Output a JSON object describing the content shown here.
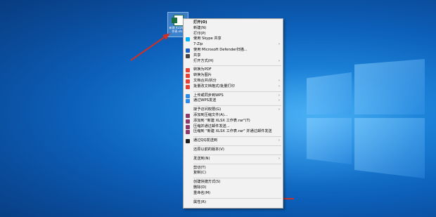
{
  "desktop_icon": {
    "label": "新建 XLSX 工作表.xlsx"
  },
  "menu": {
    "groups": [
      [
        {
          "label": "打开(O)",
          "bold": true
        },
        {
          "label": "新建(N)"
        },
        {
          "label": "打印(P)"
        },
        {
          "label": "使用 Skype 共享",
          "icon": "skype-icon"
        },
        {
          "label": "7-Zip",
          "submenu": true
        },
        {
          "label": "使用 Microsoft Defender扫描...",
          "icon": "defender-icon"
        },
        {
          "label": "共享",
          "icon": "share-icon"
        },
        {
          "label": "打开方式(H)",
          "submenu": true
        }
      ],
      [
        {
          "label": "转换为PDF",
          "icon": "wps-pdf-icon"
        },
        {
          "label": "转换为图片",
          "icon": "wps-image-icon"
        },
        {
          "label": "文档合并/拆分",
          "icon": "wps-merge-icon",
          "submenu": true
        },
        {
          "label": "批量改文档格式/批量打印",
          "icon": "wps-batch-icon",
          "submenu": true
        }
      ],
      [
        {
          "label": "上传或同步到WPS",
          "icon": "wps-cloud-icon",
          "submenu": true
        },
        {
          "label": "通过WPS发送",
          "icon": "wps-send-icon",
          "submenu": true
        }
      ],
      [
        {
          "label": "授予访问权限(G)",
          "submenu": true
        },
        {
          "label": "添加到压缩文件(A)...",
          "icon": "winrar-icon"
        },
        {
          "label": "添加到 \"新建 XLSX 工作表.rar\"(T)",
          "icon": "winrar-icon"
        },
        {
          "label": "压缩并通过邮件发送...",
          "icon": "winrar-icon"
        },
        {
          "label": "压缩到 \"新建 XLSX 工作表.rar\" 并通过邮件发送",
          "icon": "winrar-icon"
        }
      ],
      [
        {
          "label": "通过QQ发送到",
          "icon": "qq-icon",
          "submenu": true
        }
      ],
      [
        {
          "label": "还原以前的版本(V)"
        }
      ],
      [
        {
          "label": "发送到(N)",
          "submenu": true
        }
      ],
      [
        {
          "label": "剪切(T)"
        },
        {
          "label": "复制(C)"
        }
      ],
      [
        {
          "label": "创建快捷方式(S)"
        },
        {
          "label": "删除(D)"
        },
        {
          "label": "重命名(M)"
        }
      ],
      [
        {
          "label": "属性(R)"
        }
      ]
    ]
  },
  "colors": {
    "skype-icon": "#00aff0",
    "defender-icon": "#1f5fbf",
    "share-icon": "#444444",
    "wps-pdf-icon": "#e0433a",
    "wps-image-icon": "#e0433a",
    "wps-merge-icon": "#e0433a",
    "wps-batch-icon": "#e0433a",
    "wps-cloud-icon": "#2f8ae5",
    "wps-send-icon": "#2f8ae5",
    "winrar-icon": "#8b3b6b",
    "qq-icon": "#1d1d1d",
    "arrow": "#c8322a"
  }
}
